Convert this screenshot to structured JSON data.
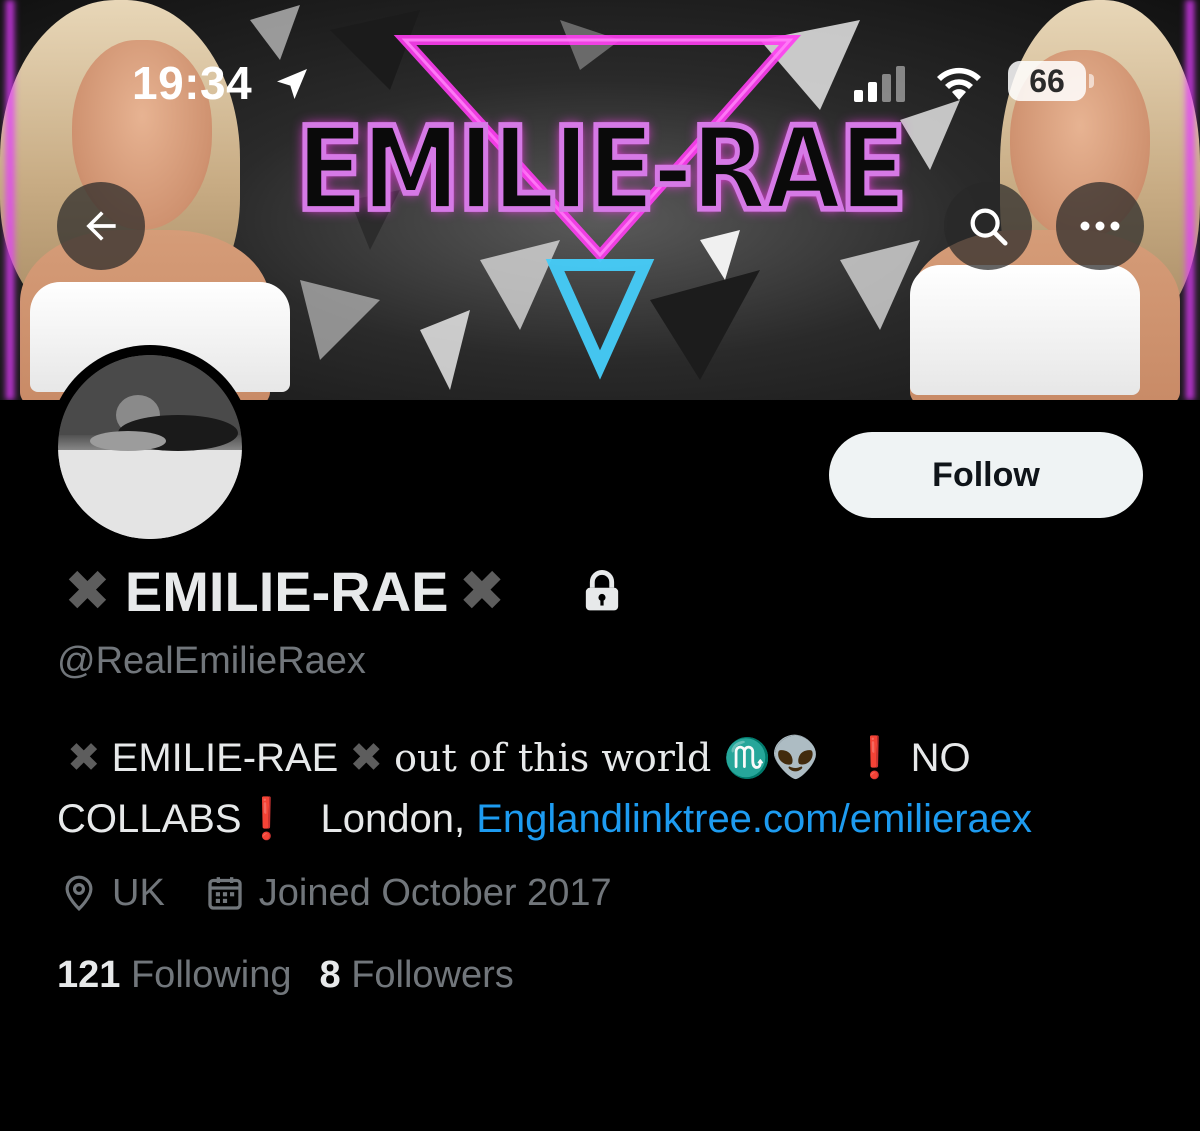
{
  "status_bar": {
    "time": "19:34",
    "battery": "66"
  },
  "banner": {
    "logo_text": "EMILIE-RAE"
  },
  "profile": {
    "display_name": "EMILIE-RAE",
    "name_decoration": "✖",
    "handle": "@RealEmilieRaex",
    "follow_label": "Follow",
    "bio": {
      "prefix_mark": "✖",
      "name": "EMILIE-RAE",
      "suffix_mark": "✖",
      "fancy_text": "out of this world ♏",
      "alien_emoji": "👽",
      "exclaim_1": "❗",
      "text_1": "NO",
      "text_2": "COLLABS",
      "exclaim_2": "❗",
      "location_text": "London,",
      "link": "Englandlinktree.com/emilieraex"
    },
    "location": "UK",
    "joined": "Joined October 2017",
    "following_count": "121",
    "following_label": "Following",
    "followers_count": "8",
    "followers_label": "Followers"
  },
  "colors": {
    "background": "#000000",
    "text_primary": "#e7e9ea",
    "text_secondary": "#71767b",
    "link": "#1d9bf0",
    "follow_bg": "#eff3f4",
    "accent_pink": "#e23cff",
    "exclaim_red": "#e0242b"
  }
}
